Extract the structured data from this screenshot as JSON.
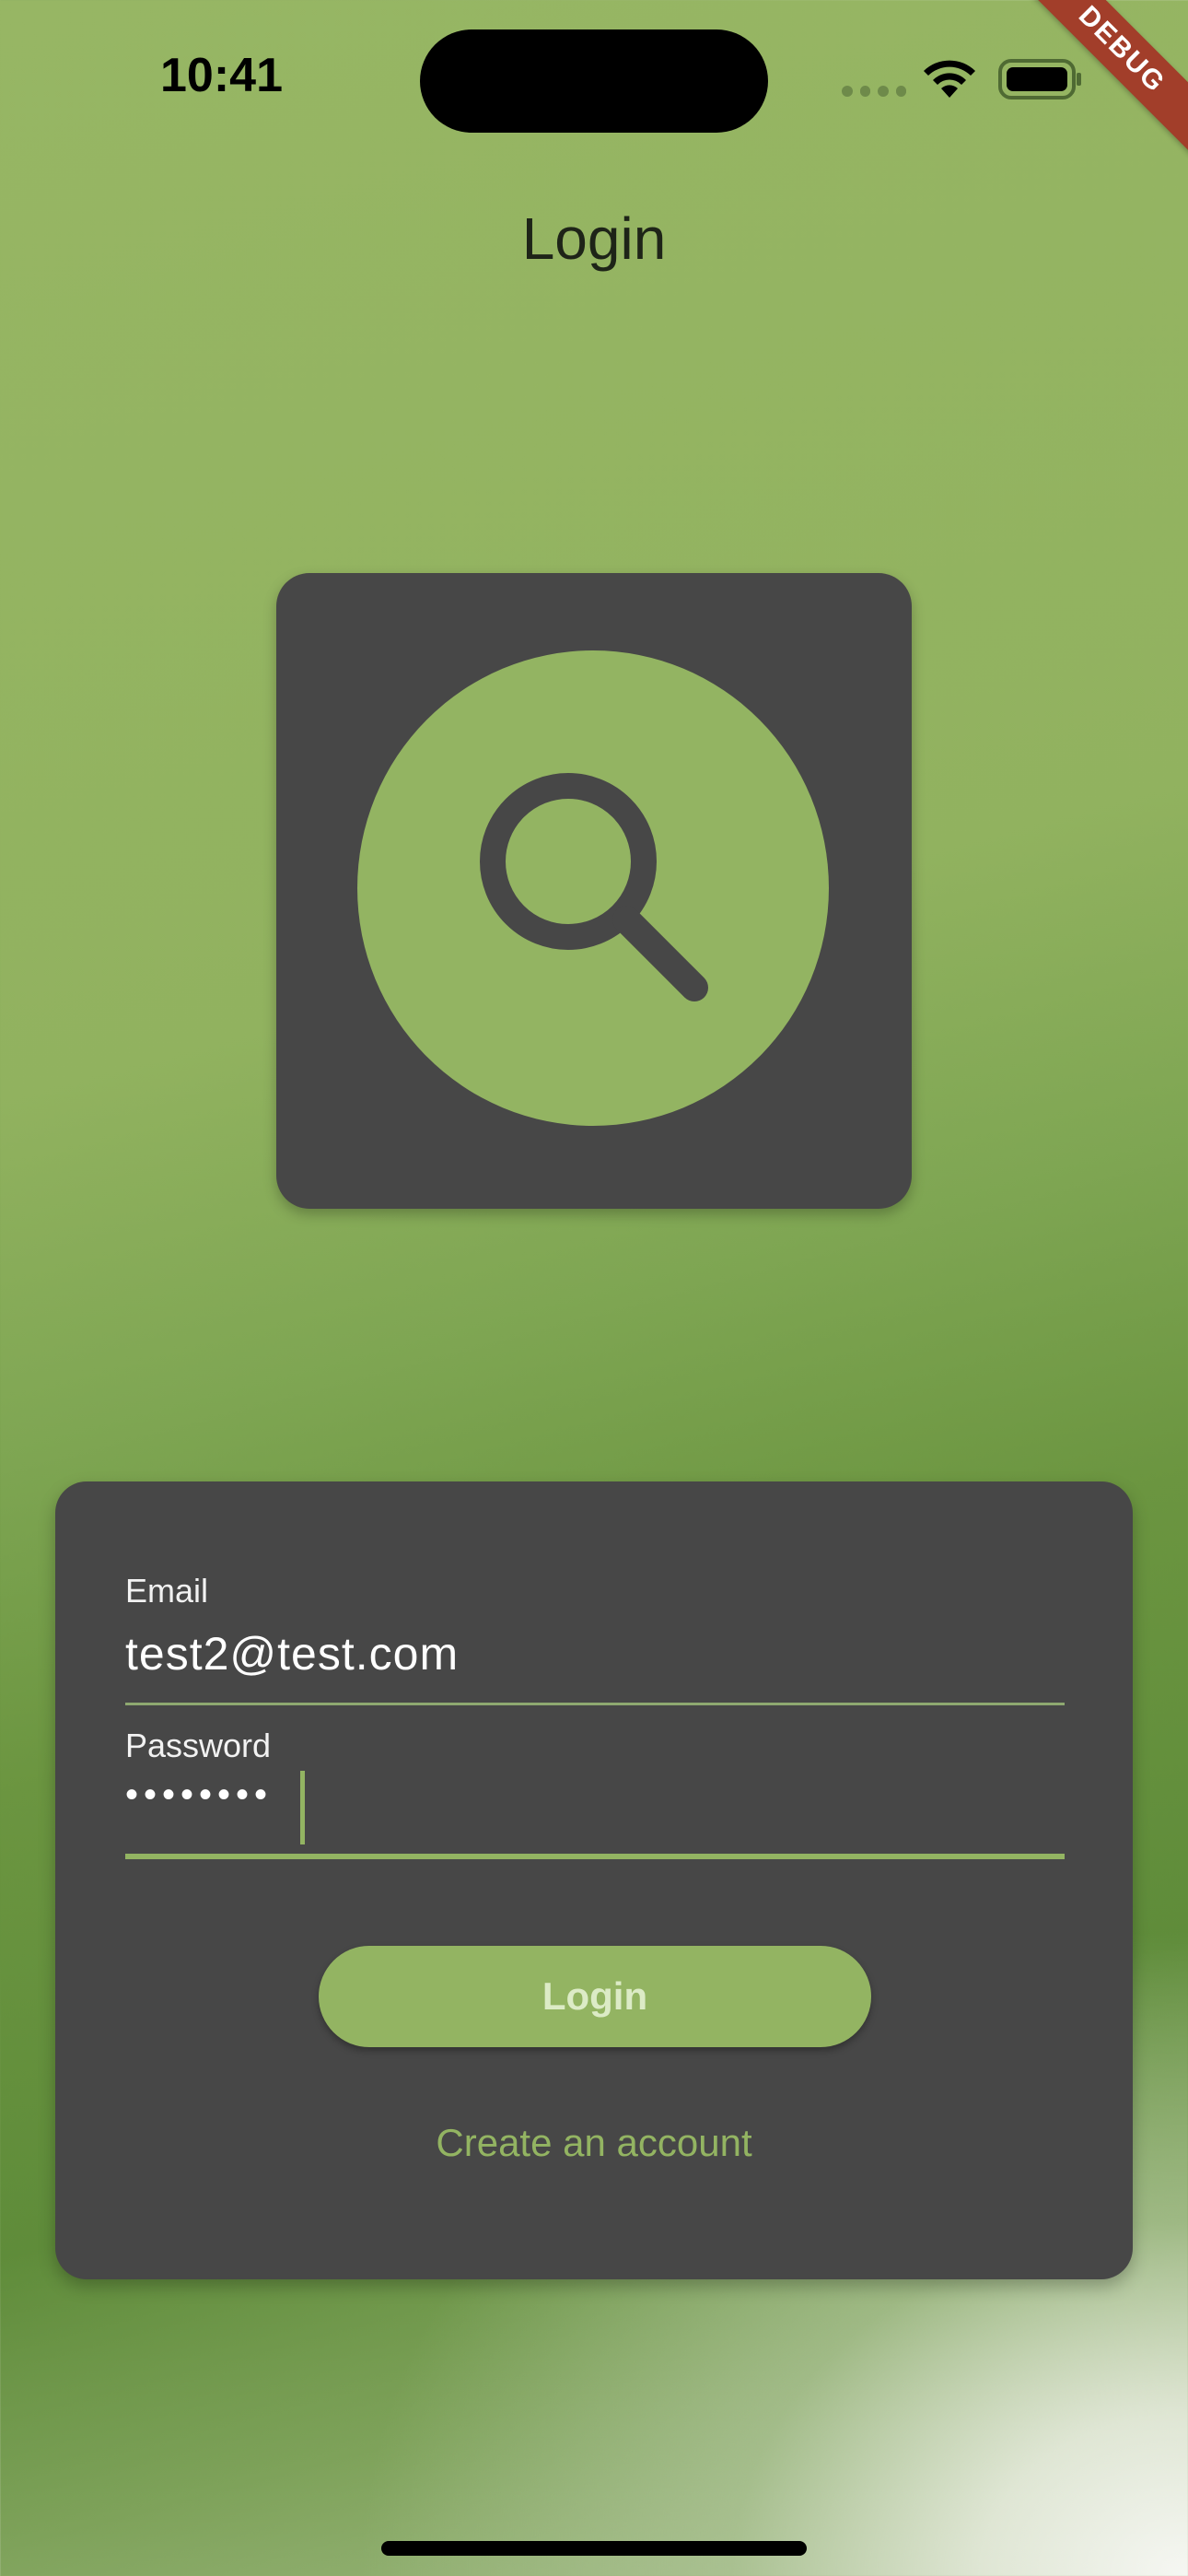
{
  "status_bar": {
    "time": "10:41"
  },
  "debug_banner": {
    "label": "DEBUG"
  },
  "header": {
    "title": "Login"
  },
  "logo": {
    "icon": "search-icon",
    "accent_color": "#93b462",
    "tile_color": "#474747"
  },
  "form": {
    "email": {
      "label": "Email",
      "value": "test2@test.com"
    },
    "password": {
      "label": "Password",
      "masked_value": "••••••••"
    },
    "login_button_label": "Login",
    "create_account_label": "Create an account"
  },
  "colors": {
    "accent": "#93b462",
    "card": "#474747",
    "background": "#91b25f"
  }
}
